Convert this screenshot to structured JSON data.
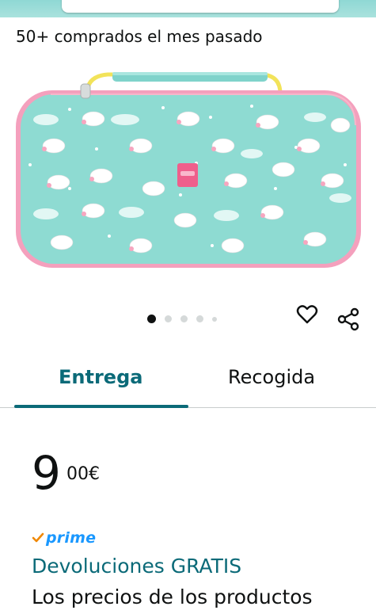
{
  "social_proof": {
    "bought_text": "50+ comprados el mes pasado"
  },
  "product": {
    "image_name": "unicorn-switch-case-image",
    "carousel": {
      "count": 5,
      "active": 1
    }
  },
  "actions": {
    "wishlist_icon": "heart-icon",
    "share_icon": "share-icon"
  },
  "tabs": [
    {
      "label": "Entrega",
      "selected": true
    },
    {
      "label": "Recogida",
      "selected": false
    }
  ],
  "price": {
    "whole": "9",
    "fraction": "00",
    "currency": "€"
  },
  "prime": {
    "check": "✓",
    "label": "prime"
  },
  "returns": {
    "label": "Devoluciones GRATIS"
  },
  "note": {
    "text": "Los precios de los productos"
  },
  "colors": {
    "accent": "#0b6a78",
    "prime": "#1a98ff",
    "case_body": "#8dd9d1",
    "case_trim": "#f5a3bf"
  }
}
